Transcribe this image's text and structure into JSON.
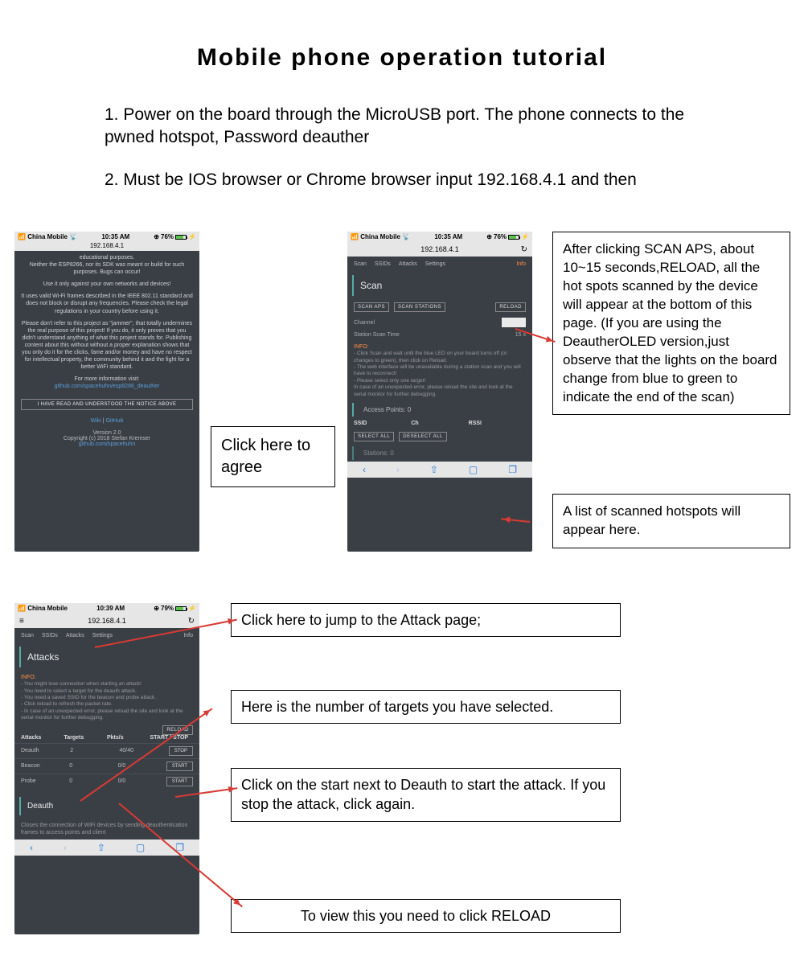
{
  "title": "Mobile phone operation tutorial",
  "intro": {
    "step1": "1. Power on the board through the MicroUSB port. The phone connects to the pwned hotspot, Password deauther",
    "step2": "2. Must be IOS browser or Chrome browser input 192.168.4.1 and then"
  },
  "phone1": {
    "carrier": "China Mobile",
    "time": "10:35 AM",
    "battery": "76%",
    "url": "192.168.4.1",
    "body_l1": "educational purposes.",
    "body_l2": "Neither the ESP8266, nor its SDK was meant or build for such purposes. Bugs can occur!",
    "body_l3": "Use it only against your own networks and devices!",
    "body_l4": "It uses valid Wi-Fi frames described in the IEEE 802.11 standard and does not block or disrupt any frequencies. Please check the legal regulations in your country before using it.",
    "body_l5": "Please don't refer to this project as \"jammer\", that totally undermines the real purpose of this project! If you do, it only proves that you didn't understand anything of what this project stands for. Publishing content about this without without a proper explanation shows that you only do it for the clicks, fame and/or money and have no respect for intellectual property, the community behind it and the fight for a better WiFi standard.",
    "body_l6": "For more information visit:",
    "body_link": "github.com/spacehuhn/esp8266_deauther",
    "agree_btn": "I HAVE READ AND UNDERSTOOD THE NOTICE ABOVE",
    "wiki": "Wiki",
    "github": "GitHub",
    "version": "Version 2.0",
    "copyright": "Copyright (c) 2018 Stefan Kremser",
    "gh_link": "github.com/spacehuhn"
  },
  "phone2": {
    "carrier": "China Mobile",
    "time": "10:35 AM",
    "battery": "76%",
    "url": "192.168.4.1",
    "tabs": {
      "scan": "Scan",
      "ssids": "SSIDs",
      "attacks": "Attacks",
      "settings": "Settings",
      "info": "Info"
    },
    "section": "Scan",
    "btn_scan_aps": "SCAN APS",
    "btn_scan_stations": "SCAN STATIONS",
    "btn_reload": "RELOAD",
    "channel_label": "Channel",
    "scan_time_label": "Station Scan Time",
    "scan_time_val": "15 s",
    "info_hd": "INFO:",
    "info_body": "- Click Scan and wait until the blue LED on your board turns off (or changes to green), then click on Reload.\n- The web interface will be unavailable during a station scan and you will have to reconnect!\n- Please select only one target!\nIn case of an unexpected error, please reload the site and look at the serial monitor for further debugging.",
    "ap_header": "Access Points: 0",
    "th_ssid": "SSID",
    "th_ch": "Ch",
    "th_rssi": "RSSI",
    "btn_select_all": "SELECT ALL",
    "btn_deselect_all": "DESELECT ALL",
    "stations_header": "Stations: 0"
  },
  "phone3": {
    "carrier": "China Mobile",
    "time": "10:39 AM",
    "battery": "79%",
    "url": "192.168.4.1",
    "tabs": {
      "scan": "Scan",
      "ssids": "SSIDs",
      "attacks": "Attacks",
      "settings": "Settings",
      "info": "Info"
    },
    "section": "Attacks",
    "info_hd": "INFO:",
    "info_body": "- You might lose connection when starting an attack!\n- You need to select a target for the deauth attack.\n- You need a saved SSID for the beacon and probe attack.\n- Click reload to refresh the packet rate.\n- In case of an unexpected error, please reload the site and look at the serial monitor for further debugging.",
    "btn_reload": "RELOAD",
    "th_attacks": "Attacks",
    "th_targets": "Targets",
    "th_pkts": "Pkts/s",
    "th_ss": "START / STOP",
    "rows": [
      {
        "name": "Deauth",
        "targets": "2",
        "pkts": "40/40",
        "btn": "STOP"
      },
      {
        "name": "Beacon",
        "targets": "0",
        "pkts": "0/0",
        "btn": "START"
      },
      {
        "name": "Probe",
        "targets": "0",
        "pkts": "0/0",
        "btn": "START"
      }
    ],
    "deauth_h": "Deauth",
    "deauth_desc": "Closes the connection of WiFi devices by sending deauthentication frames to access points and client"
  },
  "annotations": {
    "a1": "Click here to agree",
    "a2": "After clicking SCAN APS, about 10~15 seconds,RELOAD, all the hot spots scanned by the device will appear at the bottom of this page. (If you are using the DeautherOLED version,just observe that the lights on the board change from blue to green to indicate the end of the scan)",
    "a3": "A list of scanned hotspots will appear here.",
    "a4": "Click here to jump to the Attack page;",
    "a5": "Here is the number of targets you have selected.",
    "a6": "Click on the start next to Deauth to start the attack. If you stop the attack, click again.",
    "a7": "To view this you need to click RELOAD"
  }
}
